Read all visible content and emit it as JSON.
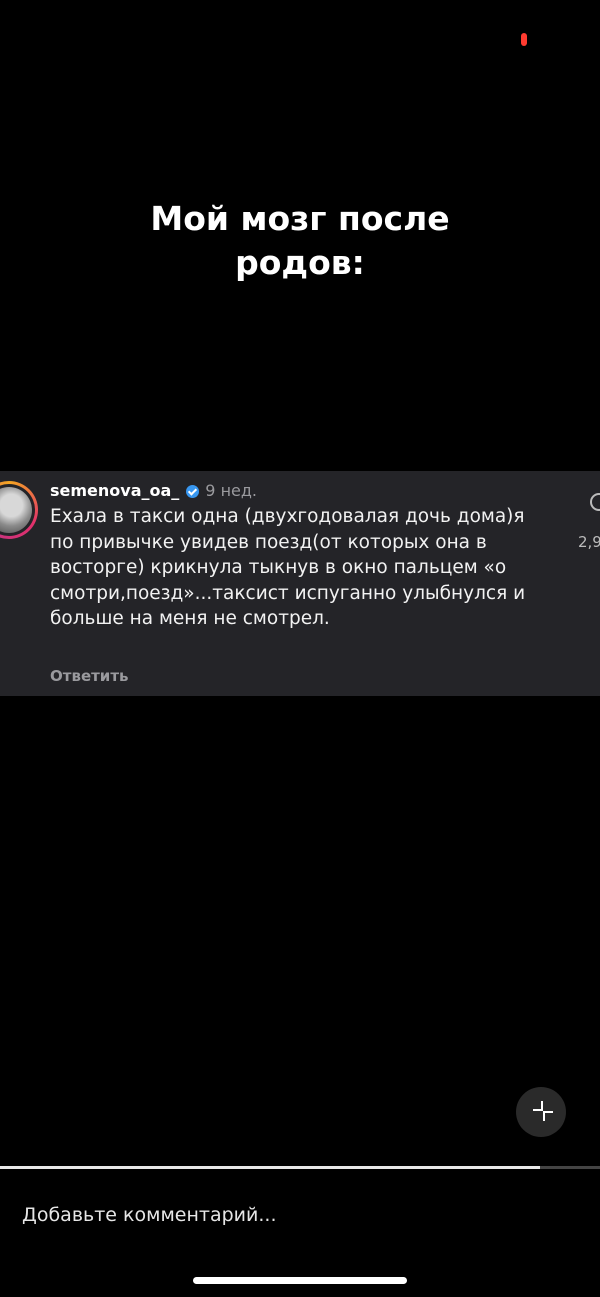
{
  "status": {
    "indicator_color": "#ff3b30"
  },
  "overlay": {
    "title_line1": "Мой мозг после",
    "title_line2": "родов:"
  },
  "comment": {
    "username": "semenova_oa_",
    "verified": true,
    "time": "9 нед.",
    "text": "Ехала в такси одна (двухгодовалая дочь дома)я по привычке увидев поезд(от которых она в восторге) крикнула тыкнув в окно пальцем «о смотри,поезд»...таксист испуганно улыбнулся и больше на меня не смотрел.",
    "reply_label": "Ответить",
    "like_count": "2,9",
    "like_icon": "heart-icon"
  },
  "player": {
    "exit_fullscreen_icon": "exit-fullscreen-icon",
    "progress_percent": 90
  },
  "composer": {
    "placeholder": "Добавьте комментарий..."
  },
  "colors": {
    "background": "#000000",
    "card": "#242428",
    "verified": "#3897f0",
    "muted_text": "#9a9a9e"
  }
}
